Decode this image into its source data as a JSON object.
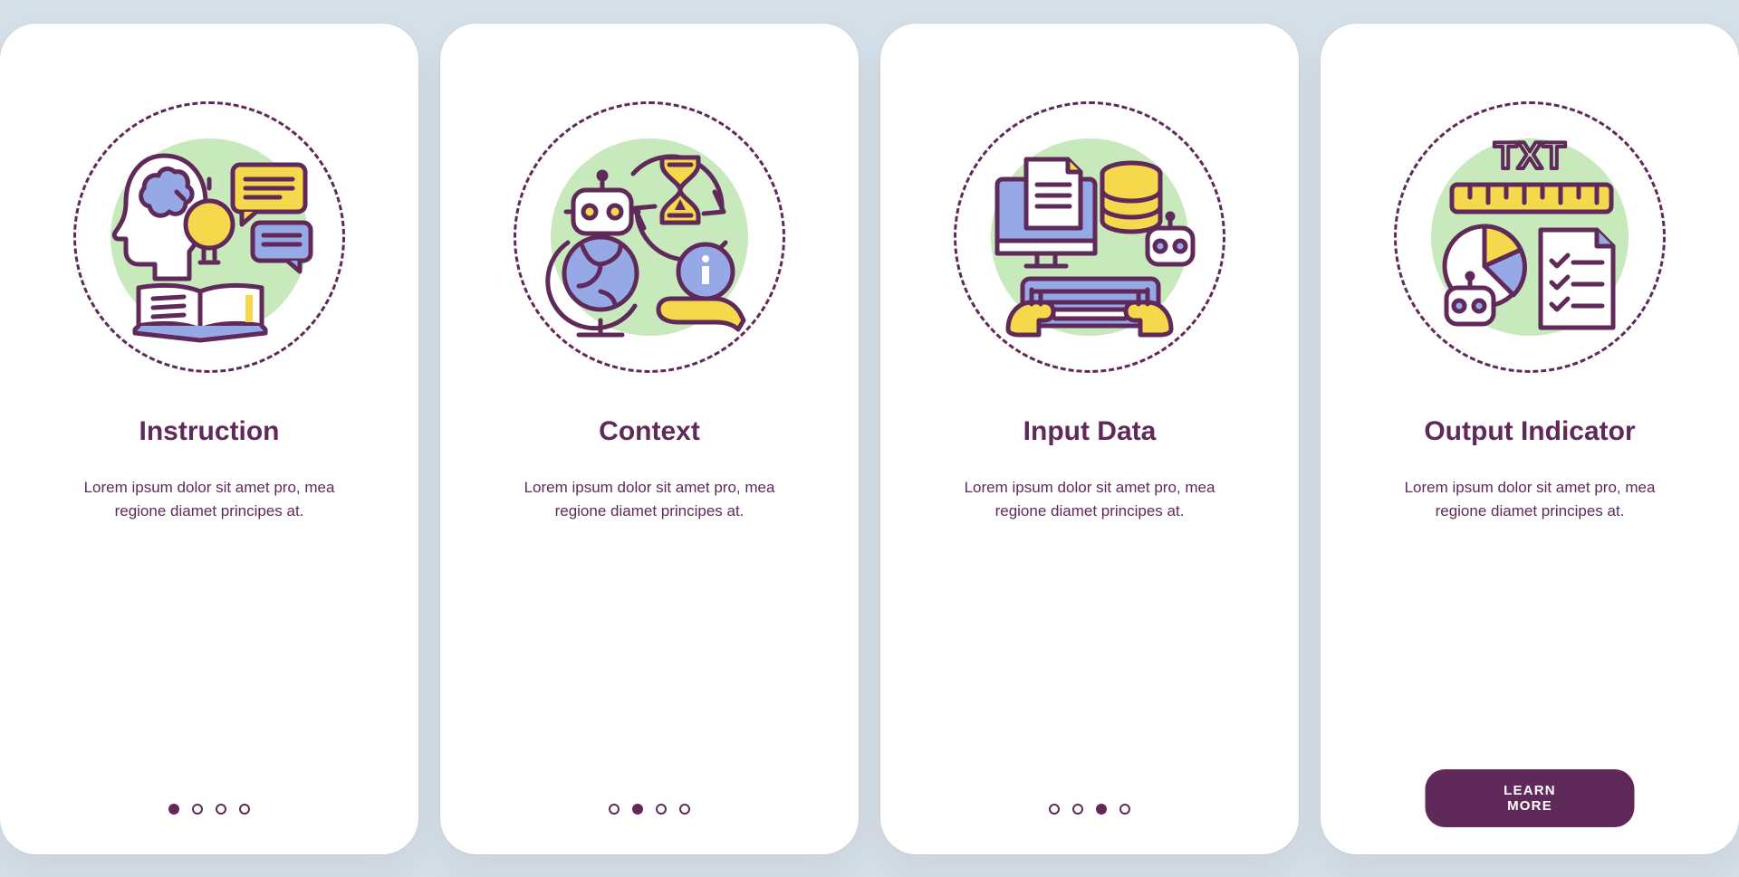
{
  "cards": [
    {
      "title": "Instruction",
      "desc": "Lorem ipsum dolor sit amet pro, mea regione diamet principes at.",
      "activeDot": 0,
      "icon": "instruction-icon",
      "cta": null
    },
    {
      "title": "Context",
      "desc": "Lorem ipsum dolor sit amet pro, mea regione diamet principes at.",
      "activeDot": 1,
      "icon": "context-icon",
      "cta": null
    },
    {
      "title": "Input Data",
      "desc": "Lorem ipsum dolor sit amet pro, mea regione diamet principes at.",
      "activeDot": 2,
      "icon": "input-data-icon",
      "cta": null
    },
    {
      "title": "Output Indicator",
      "desc": "Lorem ipsum dolor sit amet pro, mea regione diamet principes at.",
      "activeDot": 3,
      "icon": "output-indicator-icon",
      "cta": "LEARN MORE"
    }
  ],
  "dotCount": 4,
  "colors": {
    "primary": "#5f2a5a",
    "yellow": "#f5d84c",
    "blue": "#97a8e6",
    "green": "#c7e9bc",
    "background": "#d5dfe7"
  }
}
